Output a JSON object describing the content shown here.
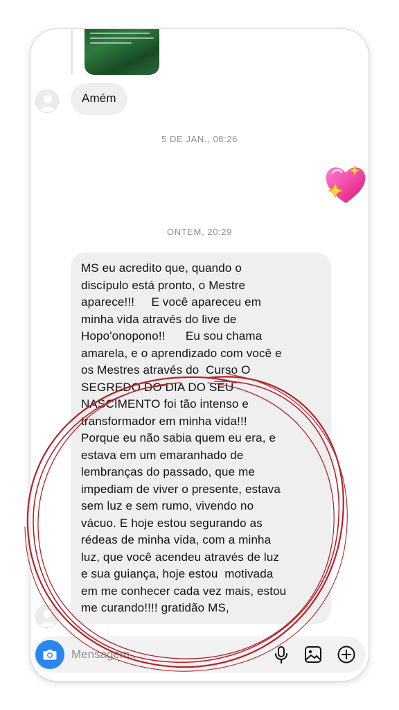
{
  "thread": {
    "shared_post": {
      "lines": [
        "",
        "",
        "",
        ""
      ],
      "signature": ""
    },
    "messages": [
      {
        "text": "Amém"
      },
      {
        "text": "MS eu acredito que, quando o\ndiscípulo está pronto, o Mestre\naparece!!!     E você apareceu em\nminha vida através do live de\nHopo'onopono!!      Eu sou chama\namarela, e o aprendizado com você e\nos Mestres através do  Curso O\nSEGREDO DO DIA DO SEU\nNASCIMENTO foi tão intenso e\ntransformador em minha vida!!!\nPorque eu não sabia quem eu era, e\nestava em um emaranhado de\nlembranças do passado, que me\nimpediam de viver o presente, estava\nsem luz e sem rumo, vivendo no\nvácuo. E hoje estou segurando as\nrédeas de minha vida, com a minha\nluz, que você acendeu através de luz\ne sua guiança, hoje estou  motivada\nem me conhecer cada vez mais, estou\nme curando!!!! gratidão MS,"
      }
    ],
    "timestamps": [
      "5 DE JAN., 08:26",
      "ONTEM, 20:29"
    ],
    "reaction_icon": "sparkling-heart-icon"
  },
  "composer": {
    "placeholder": "Mensagem...",
    "value": "",
    "icons": [
      "camera-icon",
      "microphone-icon",
      "gallery-icon",
      "plus-circle-icon"
    ],
    "accent_color": "#2a86ef"
  },
  "annotation": {
    "color": "#b3232b",
    "shape": "hand-drawn-circle"
  },
  "colors": {
    "bubble": "#efefef",
    "timestamp": "#8e8e8e",
    "text": "#111111"
  }
}
